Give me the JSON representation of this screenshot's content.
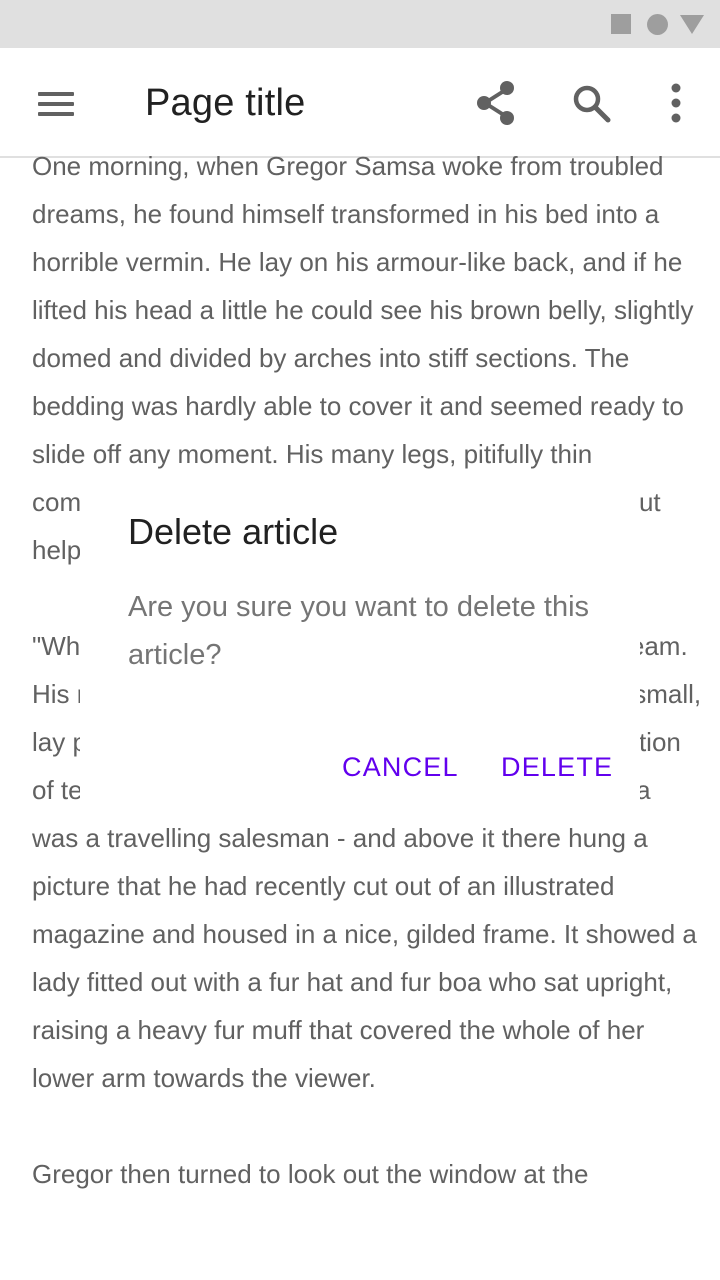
{
  "status_bar": {
    "icons": [
      "square-icon",
      "circle-icon",
      "triangle-icon"
    ]
  },
  "app_bar": {
    "title": "Page title",
    "icons": [
      "menu-icon",
      "share-icon",
      "search-icon",
      "more-vert-icon"
    ]
  },
  "article": {
    "paragraphs": [
      "One morning, when Gregor Samsa woke from troubled dreams, he found himself transformed in his bed into a horrible vermin. He lay on his armour-like back, and if he lifted his head a little he could see his brown belly, slightly domed and divided by arches into stiff sections. The bedding was hardly able to cover it and seemed ready to slide off any moment. His many legs, pitifully thin compared with the size of the rest of him, waved about helplessly as he looked.",
      "\"What's happened to me?\" he thought. It wasn't a dream. His room, a proper human room although a little too small, lay peacefully between its four familiar walls. A collection of textile samples lay spread out on the table - Samsa was a travelling salesman - and above it there hung a picture that he had recently cut out of an illustrated magazine and housed in a nice, gilded frame. It showed a lady fitted out with a fur hat and fur boa who sat upright, raising a heavy fur muff that covered the whole of her lower arm towards the viewer.",
      "Gregor then turned to look out the window at the"
    ]
  },
  "dialog": {
    "title": "Delete article",
    "message": "Are you sure you want to delete this article?",
    "cancel_label": "CANCEL",
    "delete_label": "DELETE"
  },
  "colors": {
    "accent": "#6200ee",
    "status_bar": "#e0e0e0",
    "icon": "#616161",
    "body_text": "#616161"
  }
}
